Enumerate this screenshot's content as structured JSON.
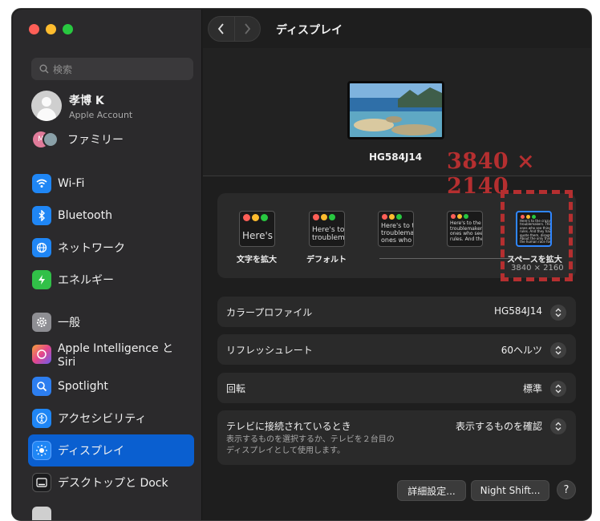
{
  "window": {
    "title": "ディスプレイ"
  },
  "sidebar": {
    "search_placeholder": "検索",
    "account": {
      "name": "孝博 K",
      "subtitle": "Apple Account"
    },
    "family": {
      "label": "ファミリー"
    },
    "items": [
      {
        "label": "Wi-Fi",
        "icon": "wifi-icon",
        "color": "#1f86f5"
      },
      {
        "label": "Bluetooth",
        "icon": "bluetooth-icon",
        "color": "#1f86f5"
      },
      {
        "label": "ネットワーク",
        "icon": "globe-icon",
        "color": "#1f86f5"
      },
      {
        "label": "エネルギー",
        "icon": "battery-bolt-icon",
        "color": "#31c048"
      },
      {
        "label": "一般",
        "icon": "gear-icon",
        "color": "#8e8e93"
      },
      {
        "label": "Apple Intelligence と Siri",
        "icon": "siri-icon",
        "color": "#c257d9"
      },
      {
        "label": "Spotlight",
        "icon": "magnifier-icon",
        "color": "#2d7ef0"
      },
      {
        "label": "アクセシビリティ",
        "icon": "accessibility-icon",
        "color": "#1f86f5"
      },
      {
        "label": "ディスプレイ",
        "icon": "sun-icon",
        "color": "#1f86f5",
        "selected": true
      },
      {
        "label": "デスクトップと Dock",
        "icon": "dock-icon",
        "color": "#1c1c1e"
      }
    ]
  },
  "display": {
    "monitor_name": "HG584J14",
    "resolution_overlay": "3840 × 2140",
    "scale_options": [
      {
        "label": "文字を拡大",
        "preview": "Here's"
      },
      {
        "label": "デフォルト",
        "preview": "Here's to\ntroublem"
      },
      {
        "label": "",
        "preview": "Here's to t\ntroublema\nones who"
      },
      {
        "label": "",
        "preview": "Here's to the\ntroublemakers.\nones who see th\nrules. And they"
      },
      {
        "label": "スペースを拡大",
        "sub": "3840 × 2160",
        "preview": "Here's to the crazy ones\ntroublemakers. The round\nones who see things diff\nrules. And they have no r\nquote them, disagree wit\nAbout the only thing you\nthe human race forward."
      }
    ],
    "rows": [
      {
        "label": "カラープロファイル",
        "value": "HG584J14"
      },
      {
        "label": "リフレッシュレート",
        "value": "60ヘルツ"
      },
      {
        "label": "回転",
        "value": "標準"
      },
      {
        "label": "テレビに接続されているとき",
        "value": "表示するものを確認",
        "desc": "表示するものを選択するか、テレビを２台目の\nディスプレイとして使用します。"
      }
    ],
    "buttons": {
      "advanced": "詳細設定...",
      "night_shift": "Night Shift...",
      "help": "?"
    }
  },
  "colors": {
    "accent": "#0a5fd0",
    "annotation": "#b52f30"
  }
}
